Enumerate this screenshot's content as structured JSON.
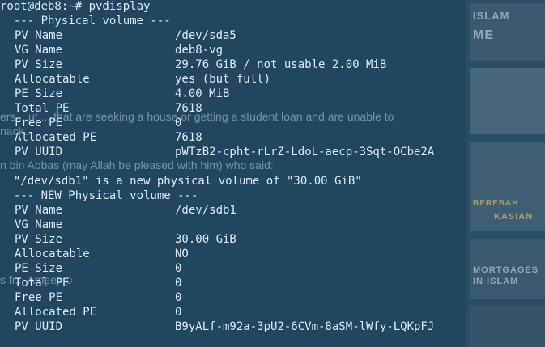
{
  "terminal": {
    "prompt": "root@deb8:~# pvdisplay",
    "section1_header": "  --- Physical volume ---",
    "pv1": [
      {
        "key": "PV Name",
        "value": "/dev/sda5"
      },
      {
        "key": "VG Name",
        "value": "deb8-vg"
      },
      {
        "key": "PV Size",
        "value": "29.76 GiB / not usable 2.00 MiB"
      },
      {
        "key": "Allocatable",
        "value": "yes (but full)"
      },
      {
        "key": "PE Size",
        "value": "4.00 MiB"
      },
      {
        "key": "Total PE",
        "value": "7618"
      },
      {
        "key": "Free PE",
        "value": "0"
      },
      {
        "key": "Allocated PE",
        "value": "7618"
      },
      {
        "key": "PV UUID",
        "value": "pWTzB2-cpht-rLrZ-LdoL-aecp-3Sqt-OCbe2A"
      }
    ],
    "blank_line": "",
    "new_pv_message": "  \"/dev/sdb1\" is a new physical volume of \"30.00 GiB\"",
    "section2_header": "  --- NEW Physical volume ---",
    "pv2": [
      {
        "key": "PV Name",
        "value": "/dev/sdb1"
      },
      {
        "key": "VG Name",
        "value": ""
      },
      {
        "key": "PV Size",
        "value": "30.00 GiB"
      },
      {
        "key": "Allocatable",
        "value": "NO"
      },
      {
        "key": "PE Size",
        "value": "0"
      },
      {
        "key": "Total PE",
        "value": "0"
      },
      {
        "key": "Free PE",
        "value": "0"
      },
      {
        "key": "Allocated PE",
        "value": "0"
      },
      {
        "key": "PV UUID",
        "value": "B9yALf-m92a-3pU2-6CVm-8aSM-lWfy-LQKpFJ"
      }
    ]
  },
  "background_page": {
    "text_lines": [
      "ers ...ut ... that are seeking a house or getting a student loan and are unable to",
      "nack...",
      "n bin Abbas (may Allah be pleased with him) who said:",
      "s fr... Ameen☺"
    ],
    "sidebar_labels": [
      "ISLAM",
      "ME",
      "BEREBAH",
      "KASIAN",
      "MORTGAGES",
      "IN ISLAM"
    ]
  },
  "colors": {
    "terminal_bg": "#23465f",
    "terminal_text": "#dde9f1"
  }
}
